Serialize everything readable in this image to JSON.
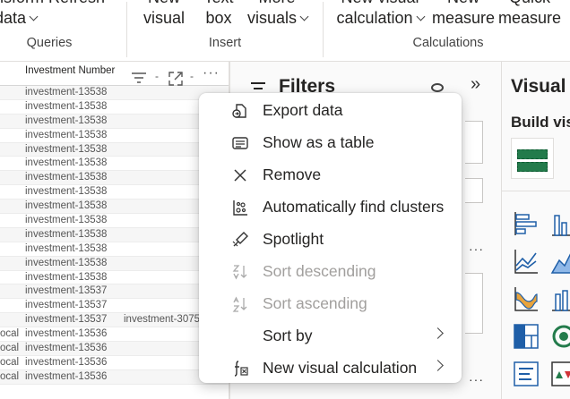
{
  "ribbon": {
    "queries": {
      "line1": "nsform Refresh",
      "line2": "data",
      "group": "Queries"
    },
    "insert": {
      "new_visual": [
        "New",
        "visual"
      ],
      "text_box": [
        "Text",
        "box"
      ],
      "more_visuals": [
        "More",
        "visuals"
      ],
      "group": "Insert"
    },
    "calculations": {
      "new_visual_calc": [
        "New visual",
        "calculation"
      ],
      "new_measure": [
        "New",
        "measure"
      ],
      "quick_measure": [
        "Quick",
        "measure"
      ],
      "group": "Calculations"
    }
  },
  "table": {
    "header": "Investment Number",
    "rows": [
      {
        "c1": "",
        "c2": "investment-13538",
        "c3": ""
      },
      {
        "c1": "",
        "c2": "investment-13538",
        "c3": ""
      },
      {
        "c1": "",
        "c2": "investment-13538",
        "c3": ""
      },
      {
        "c1": "",
        "c2": "investment-13538",
        "c3": ""
      },
      {
        "c1": "",
        "c2": "investment-13538",
        "c3": ""
      },
      {
        "c1": "",
        "c2": "investment-13538",
        "c3": ""
      },
      {
        "c1": "",
        "c2": "investment-13538",
        "c3": ""
      },
      {
        "c1": "",
        "c2": "investment-13538",
        "c3": ""
      },
      {
        "c1": "",
        "c2": "investment-13538",
        "c3": ""
      },
      {
        "c1": "",
        "c2": "investment-13538",
        "c3": ""
      },
      {
        "c1": "",
        "c2": "investment-13538",
        "c3": ""
      },
      {
        "c1": "",
        "c2": "investment-13538",
        "c3": ""
      },
      {
        "c1": "",
        "c2": "investment-13538",
        "c3": ""
      },
      {
        "c1": "",
        "c2": "investment-13538",
        "c3": ""
      },
      {
        "c1": "",
        "c2": "investment-13537",
        "c3": ""
      },
      {
        "c1": "",
        "c2": "investment-13537",
        "c3": ""
      },
      {
        "c1": "",
        "c2": "investment-13537",
        "c3": "investment-3075"
      },
      {
        "c1": "ocal",
        "c2": "investment-13536",
        "c3": ""
      },
      {
        "c1": "ocal",
        "c2": "investment-13536",
        "c3": ""
      },
      {
        "c1": "ocal",
        "c2": "investment-13536",
        "c3": ""
      },
      {
        "c1": "ocal",
        "c2": "investment-13536",
        "c3": ""
      }
    ]
  },
  "filters": {
    "title": "Filters"
  },
  "visualizations": {
    "title": "Visual",
    "build_label": "Build vis"
  },
  "context_menu": {
    "items": [
      {
        "label": "Export data",
        "icon": "export-icon",
        "disabled": false,
        "submenu": false
      },
      {
        "label": "Show as a table",
        "icon": "table-view-icon",
        "disabled": false,
        "submenu": false
      },
      {
        "label": "Remove",
        "icon": "close-icon",
        "disabled": false,
        "submenu": false
      },
      {
        "label": "Automatically find clusters",
        "icon": "clusters-icon",
        "disabled": false,
        "submenu": false
      },
      {
        "label": "Spotlight",
        "icon": "spotlight-icon",
        "disabled": false,
        "submenu": false
      },
      {
        "label": "Sort descending",
        "icon": "sort-descending-icon",
        "disabled": true,
        "submenu": false
      },
      {
        "label": "Sort ascending",
        "icon": "sort-ascending-icon",
        "disabled": true,
        "submenu": false
      },
      {
        "label": "Sort by",
        "icon": "",
        "disabled": false,
        "submenu": true
      },
      {
        "label": "New visual calculation",
        "icon": "visual-calculation-icon",
        "disabled": false,
        "submenu": true
      }
    ]
  },
  "colors": {
    "accent_green": "#237b4b",
    "accent_blue": "#1f5fa8",
    "disabled_text": "#a19f9d"
  }
}
